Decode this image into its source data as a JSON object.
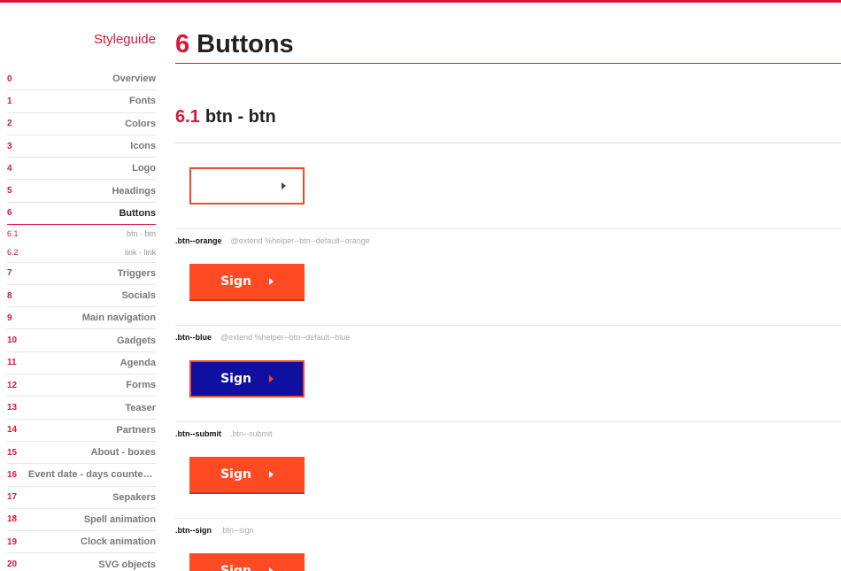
{
  "colors": {
    "accent": "#d8173a",
    "orange": "#ff4a24",
    "blue": "#1010a0"
  },
  "sidebar": {
    "title": "Styleguide",
    "items": [
      {
        "num": "0",
        "label": "Overview"
      },
      {
        "num": "1",
        "label": "Fonts"
      },
      {
        "num": "2",
        "label": "Colors"
      },
      {
        "num": "3",
        "label": "Icons"
      },
      {
        "num": "4",
        "label": "Logo"
      },
      {
        "num": "5",
        "label": "Headings"
      },
      {
        "num": "6",
        "label": "Buttons",
        "active": true
      },
      {
        "num": "7",
        "label": "Triggers"
      },
      {
        "num": "8",
        "label": "Socials"
      },
      {
        "num": "9",
        "label": "Main navigation"
      },
      {
        "num": "10",
        "label": "Gadgets"
      },
      {
        "num": "11",
        "label": "Agenda"
      },
      {
        "num": "12",
        "label": "Forms"
      },
      {
        "num": "13",
        "label": "Teaser"
      },
      {
        "num": "14",
        "label": "Partners"
      },
      {
        "num": "15",
        "label": "About - boxes"
      },
      {
        "num": "16",
        "label": "Event date - days counter…"
      },
      {
        "num": "17",
        "label": "Sepakers"
      },
      {
        "num": "18",
        "label": "Spell animation"
      },
      {
        "num": "19",
        "label": "Clock animation"
      },
      {
        "num": "20",
        "label": "SVG objects"
      }
    ],
    "subitems": [
      {
        "num": "6.1",
        "label": "btn - btn"
      },
      {
        "num": "6.2",
        "label": "link - link"
      }
    ]
  },
  "main": {
    "section_num": "6",
    "section_title": "Buttons",
    "subsection_num": "6.1",
    "subsection_title": "btn - btn",
    "default_button": {
      "arrow_icon": "caret-right-icon"
    },
    "modifiers": [
      {
        "class": ".btn--orange",
        "desc": "@extend %helper--btn--default--orange",
        "button_label": "Sign",
        "variant": "orange"
      },
      {
        "class": ".btn--blue",
        "desc": "@extend %helper--btn--default--blue",
        "button_label": "Sign",
        "variant": "blue"
      },
      {
        "class": ".btn--submit",
        "desc": ".btn--submit",
        "button_label": "Sign",
        "variant": "orange"
      },
      {
        "class": ".btn--sign",
        "desc": ".btn--sign",
        "button_label": "Sign",
        "variant": "orange"
      }
    ]
  }
}
